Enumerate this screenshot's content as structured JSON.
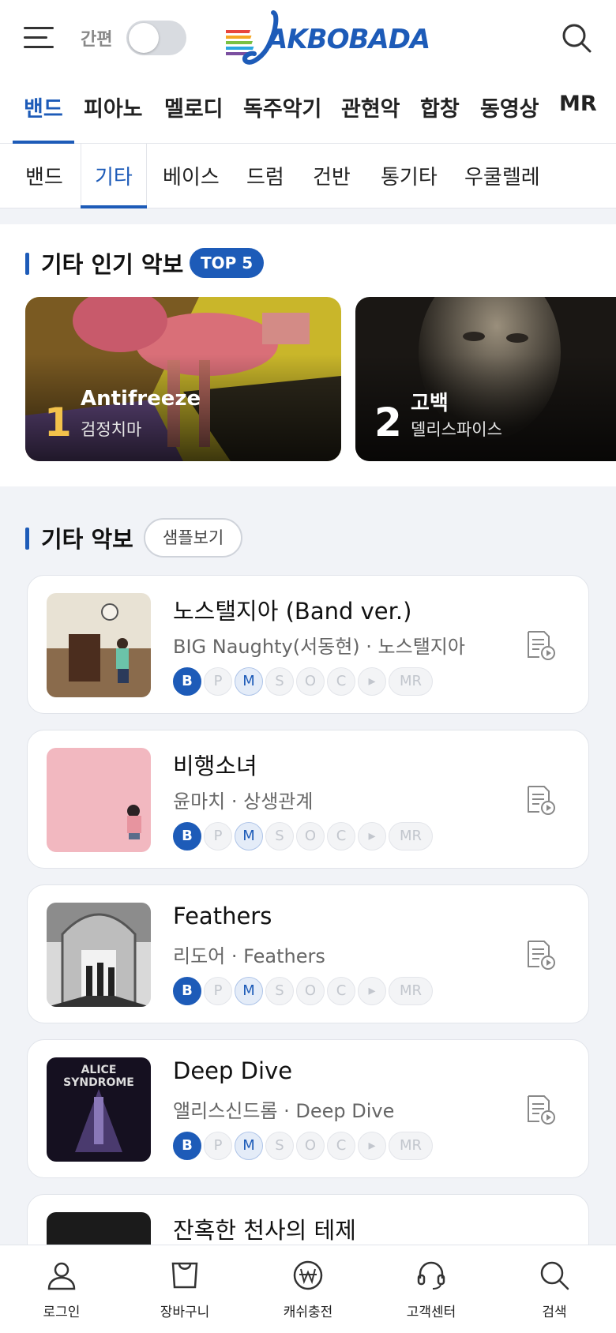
{
  "header": {
    "menu_icon": "hamburger-icon",
    "simple_mode_label": "간편",
    "simple_mode_on": false,
    "logo_text": "AKBOBADA",
    "search_icon": "search-icon"
  },
  "main_tabs": [
    "밴드",
    "피아노",
    "멜로디",
    "독주악기",
    "관현악",
    "합창",
    "동영상",
    "MR"
  ],
  "main_tab_active": "밴드",
  "sub_tabs": [
    "밴드",
    "기타",
    "베이스",
    "드럼",
    "건반",
    "통기타",
    "우쿨렐레"
  ],
  "sub_tab_active": "기타",
  "popular": {
    "title": "기타 인기 악보",
    "badge": "TOP 5",
    "cards": [
      {
        "rank": "1",
        "title": "Antifreeze",
        "artist": "검정치마"
      },
      {
        "rank": "2",
        "title": "고백",
        "artist": "델리스파이스"
      }
    ]
  },
  "sheets": {
    "title": "기타 악보",
    "sample_button": "샘플보기",
    "chip_labels": [
      "B",
      "P",
      "M",
      "S",
      "O",
      "C",
      "▸",
      "MR"
    ],
    "items": [
      {
        "title": "노스탤지아 (Band ver.)",
        "subtitle": "BIG Naughty(서동현) · 노스탤지아"
      },
      {
        "title": "비행소녀",
        "subtitle": "윤마치 · 상생관계"
      },
      {
        "title": "Feathers",
        "subtitle": "리도어 · Feathers"
      },
      {
        "title": "Deep Dive",
        "subtitle": "앨리스신드롬 · Deep Dive"
      },
      {
        "title": "잔혹한 천사의 테제",
        "subtitle": ""
      }
    ],
    "thumbnail_texts": {
      "deep_dive": "ALICE SYNDROME"
    }
  },
  "bottom_nav": [
    {
      "label": "로그인",
      "icon": "person-icon"
    },
    {
      "label": "장바구니",
      "icon": "shopping-bag-icon"
    },
    {
      "label": "캐쉬충전",
      "icon": "won-coin-icon"
    },
    {
      "label": "고객센터",
      "icon": "headset-icon"
    },
    {
      "label": "검색",
      "icon": "search-icon"
    }
  ],
  "colors": {
    "accent": "#1d5bb8",
    "rank1": "#f3c24b",
    "background": "#f1f3f7"
  }
}
